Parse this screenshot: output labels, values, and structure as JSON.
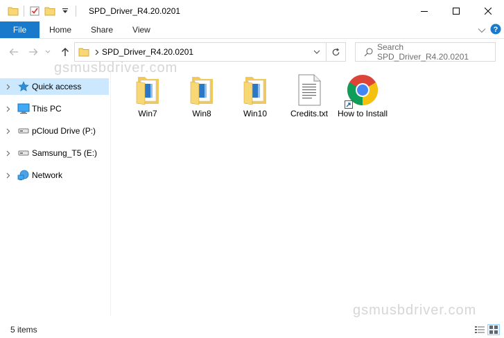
{
  "window": {
    "title": "SPD_Driver_R4.20.0201"
  },
  "ribbon": {
    "tabs": [
      "File",
      "Home",
      "Share",
      "View"
    ]
  },
  "address": {
    "path": "SPD_Driver_R4.20.0201",
    "search_placeholder": "Search SPD_Driver_R4.20.0201"
  },
  "nav": {
    "items": [
      {
        "label": "Quick access",
        "icon": "star-icon"
      },
      {
        "label": "This PC",
        "icon": "computer-icon"
      },
      {
        "label": "pCloud Drive (P:)",
        "icon": "drive-icon"
      },
      {
        "label": "Samsung_T5 (E:)",
        "icon": "drive-icon"
      },
      {
        "label": "Network",
        "icon": "network-icon"
      }
    ]
  },
  "files": [
    {
      "label": "Win7",
      "icon": "folder-icon"
    },
    {
      "label": "Win8",
      "icon": "folder-icon"
    },
    {
      "label": "Win10",
      "icon": "folder-icon"
    },
    {
      "label": "Credits.txt",
      "icon": "text-file-icon"
    },
    {
      "label": "How to Install",
      "icon": "chrome-shortcut-icon"
    }
  ],
  "watermark": "gsmusbdriver.com",
  "status": {
    "count": "5 items"
  },
  "colors": {
    "accent": "#1979ca",
    "selection": "#cce8ff",
    "folder": "#f8d775"
  }
}
